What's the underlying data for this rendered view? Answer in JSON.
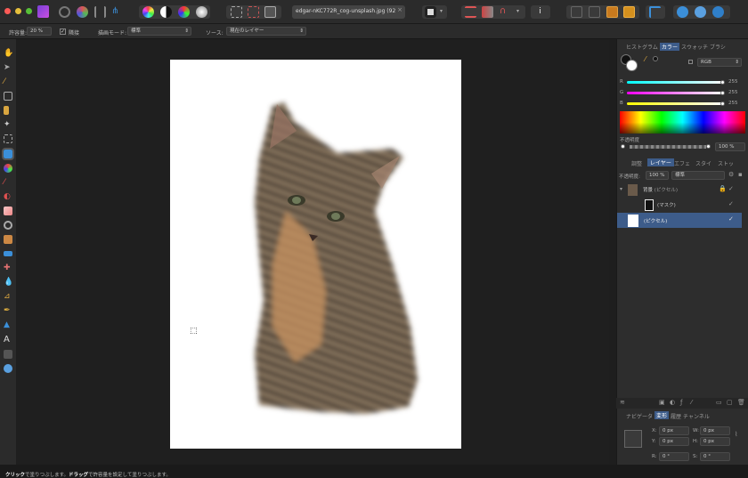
{
  "titlebar": {
    "doc_tab": "edgar-nKC772R_cog-unsplash.jpg (92",
    "doc_close": "×"
  },
  "context": {
    "tolerance_label": "許容量:",
    "tolerance_value": "20 %",
    "contiguous_label": "隣接",
    "blend_mode_label": "描画モード:",
    "blend_mode_value": "標準",
    "source_label": "ソース:",
    "source_value": "現在のレイヤー"
  },
  "panel": {
    "top_tabs": [
      "ヒストグラム",
      "カラー",
      "スウォッチ",
      "ブラシ"
    ],
    "color_model": "RGB",
    "r_label": "R",
    "r_value": "255",
    "g_label": "G",
    "g_value": "255",
    "b_label": "B",
    "b_value": "255",
    "opacity_label": "不透明度",
    "opacity_value": "100 %",
    "mid_tabs": [
      "調整",
      "レイヤー",
      "エフェ",
      "スタイ",
      "ストッ"
    ],
    "layer_opacity_label": "不透明度:",
    "layer_opacity_value": "100 %",
    "layer_blend_value": "標準",
    "layers": [
      {
        "name": "背景",
        "sub": "(ピクセル)"
      },
      {
        "name": "(マスク)",
        "sub": ""
      },
      {
        "name": "(ピクセル)",
        "sub": ""
      }
    ],
    "bottom_tabs": [
      "ナビゲータ",
      "変形",
      "履歴",
      "チャンネル"
    ],
    "x_label": "X:",
    "x_value": "0 px",
    "y_label": "Y:",
    "y_value": "0 px",
    "w_label": "W:",
    "w_value": "0 px",
    "h_label": "H:",
    "h_value": "0 px",
    "r2_label": "R:",
    "r2_value": "0 °",
    "s_label": "S:",
    "s_value": "0 °"
  },
  "status": {
    "b1": "クリック",
    "t1": "で塗りつぶします。",
    "b2": "ドラッグ",
    "t2": "で許容量を設定して塗りつぶします。"
  },
  "colors": {
    "accent": "#3d5c8a",
    "chrome": "#2b2b2b",
    "canvas": "#1f1f1f"
  }
}
